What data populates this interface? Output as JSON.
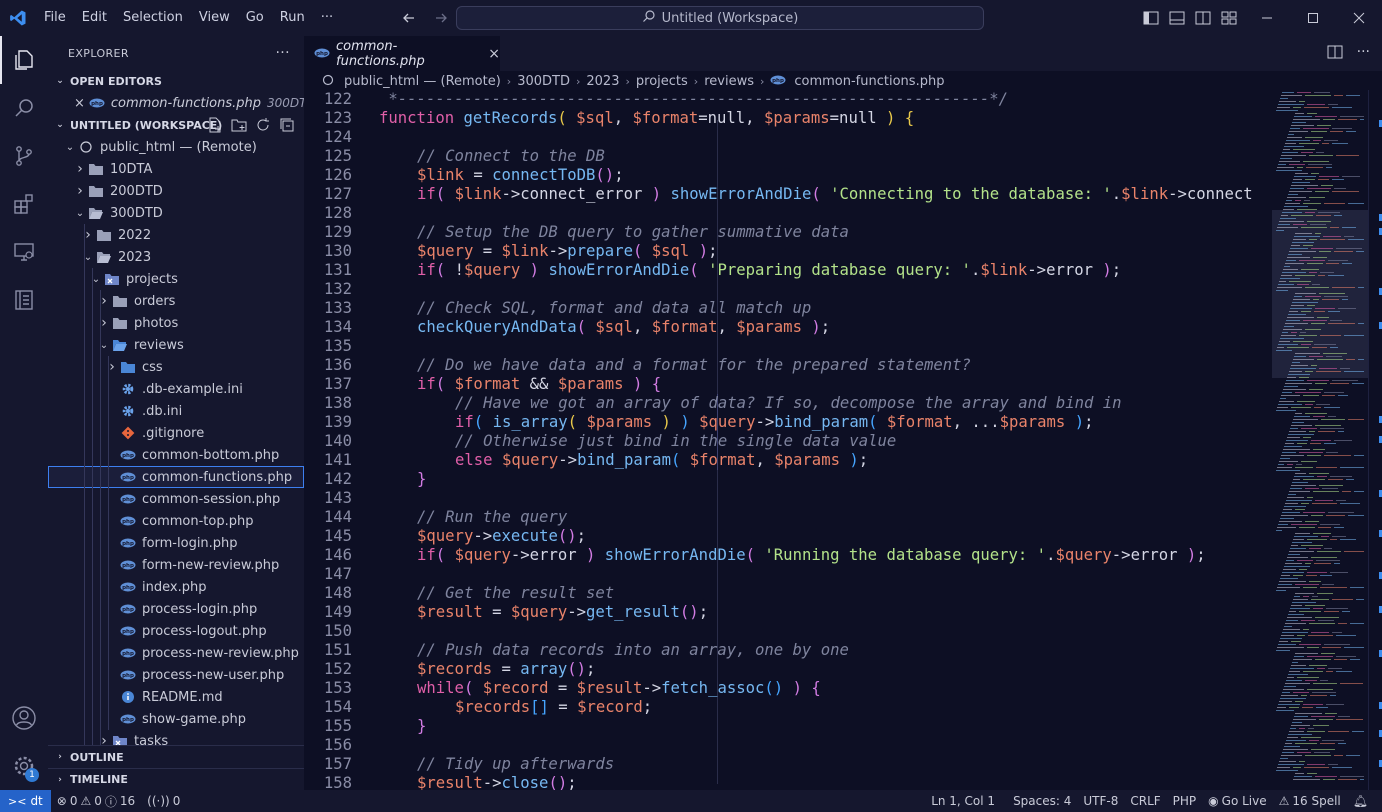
{
  "menu": [
    "File",
    "Edit",
    "Selection",
    "View",
    "Go",
    "Run",
    "···"
  ],
  "command_center": "Untitled (Workspace)",
  "sidebar": {
    "title": "EXPLORER",
    "more": "···",
    "open_editors_title": "OPEN EDITORS",
    "open_editor": {
      "name": "common-functions.php",
      "desc": "300DT..."
    },
    "workspace_title": "UNTITLED (WORKSPACE)",
    "tree": [
      {
        "label": "public_html — (Remote)",
        "depth": 0,
        "kind": "root",
        "twisty": "open"
      },
      {
        "label": "10DTA",
        "depth": 1,
        "kind": "folder",
        "twisty": "closed"
      },
      {
        "label": "200DTD",
        "depth": 1,
        "kind": "folder",
        "twisty": "closed"
      },
      {
        "label": "300DTD",
        "depth": 1,
        "kind": "folder-open",
        "twisty": "open"
      },
      {
        "label": "2022",
        "depth": 2,
        "kind": "folder",
        "twisty": "closed"
      },
      {
        "label": "2023",
        "depth": 2,
        "kind": "folder-open",
        "twisty": "open"
      },
      {
        "label": "projects",
        "depth": 3,
        "kind": "folder-special",
        "twisty": "open"
      },
      {
        "label": "orders",
        "depth": 4,
        "kind": "folder",
        "twisty": "closed"
      },
      {
        "label": "photos",
        "depth": 4,
        "kind": "folder",
        "twisty": "closed"
      },
      {
        "label": "reviews",
        "depth": 4,
        "kind": "folder-blue-open",
        "twisty": "open"
      },
      {
        "label": "css",
        "depth": 5,
        "kind": "folder-blue",
        "twisty": "closed"
      },
      {
        "label": ".db-example.ini",
        "depth": 5,
        "kind": "gear",
        "twisty": ""
      },
      {
        "label": ".db.ini",
        "depth": 5,
        "kind": "gear",
        "twisty": ""
      },
      {
        "label": ".gitignore",
        "depth": 5,
        "kind": "git",
        "twisty": ""
      },
      {
        "label": "common-bottom.php",
        "depth": 5,
        "kind": "php",
        "twisty": ""
      },
      {
        "label": "common-functions.php",
        "depth": 5,
        "kind": "php",
        "twisty": "",
        "selected": true
      },
      {
        "label": "common-session.php",
        "depth": 5,
        "kind": "php",
        "twisty": ""
      },
      {
        "label": "common-top.php",
        "depth": 5,
        "kind": "php",
        "twisty": ""
      },
      {
        "label": "form-login.php",
        "depth": 5,
        "kind": "php",
        "twisty": ""
      },
      {
        "label": "form-new-review.php",
        "depth": 5,
        "kind": "php",
        "twisty": ""
      },
      {
        "label": "index.php",
        "depth": 5,
        "kind": "php",
        "twisty": ""
      },
      {
        "label": "process-login.php",
        "depth": 5,
        "kind": "php",
        "twisty": ""
      },
      {
        "label": "process-logout.php",
        "depth": 5,
        "kind": "php",
        "twisty": ""
      },
      {
        "label": "process-new-review.php",
        "depth": 5,
        "kind": "php",
        "twisty": ""
      },
      {
        "label": "process-new-user.php",
        "depth": 5,
        "kind": "php",
        "twisty": ""
      },
      {
        "label": "README.md",
        "depth": 5,
        "kind": "info",
        "twisty": ""
      },
      {
        "label": "show-game.php",
        "depth": 5,
        "kind": "php",
        "twisty": ""
      },
      {
        "label": "tasks",
        "depth": 4,
        "kind": "folder-special",
        "twisty": "closed"
      }
    ],
    "outline_title": "OUTLINE",
    "timeline_title": "TIMELINE"
  },
  "tab": {
    "label": "common-functions.php",
    "close": "×"
  },
  "breadcrumbs": [
    "public_html — (Remote)",
    "300DTD",
    "2023",
    "projects",
    "reviews",
    "common-functions.php"
  ],
  "code": [
    {
      "n": "122",
      "i": 0,
      "t": [
        [
          "cmt",
          " *---------------------------------------------------------------*/"
        ]
      ]
    },
    {
      "n": "123",
      "i": 0,
      "t": [
        [
          "kw",
          "function "
        ],
        [
          "fn",
          "getRecords"
        ],
        [
          "br1",
          "( "
        ],
        [
          "var",
          "$sql"
        ],
        [
          "pn",
          ", "
        ],
        [
          "var",
          "$format"
        ],
        [
          "pn",
          "=null, "
        ],
        [
          "var",
          "$params"
        ],
        [
          "pn",
          "=null "
        ],
        [
          "br1",
          ")"
        ],
        [
          "pn",
          " "
        ],
        [
          "br1",
          "{"
        ]
      ]
    },
    {
      "n": "124",
      "i": 0,
      "t": []
    },
    {
      "n": "125",
      "i": 1,
      "t": [
        [
          "cmt",
          "// Connect to the DB"
        ]
      ]
    },
    {
      "n": "126",
      "i": 1,
      "t": [
        [
          "var",
          "$link"
        ],
        [
          "pn",
          " = "
        ],
        [
          "fn",
          "connectToDB"
        ],
        [
          "br2",
          "()"
        ],
        [
          "pn",
          ";"
        ]
      ]
    },
    {
      "n": "127",
      "i": 1,
      "t": [
        [
          "kw",
          "if"
        ],
        [
          "br2",
          "( "
        ],
        [
          "var",
          "$link"
        ],
        [
          "pn",
          "->connect_error "
        ],
        [
          "br2",
          ")"
        ],
        [
          "pn",
          " "
        ],
        [
          "fn",
          "showErrorAndDie"
        ],
        [
          "br2",
          "( "
        ],
        [
          "str",
          "'Connecting to the database: '"
        ],
        [
          "pn",
          "."
        ],
        [
          "var",
          "$link"
        ],
        [
          "pn",
          "->connect"
        ]
      ]
    },
    {
      "n": "128",
      "i": 0,
      "t": []
    },
    {
      "n": "129",
      "i": 1,
      "t": [
        [
          "cmt",
          "// Setup the DB query to gather summative data"
        ]
      ]
    },
    {
      "n": "130",
      "i": 1,
      "t": [
        [
          "var",
          "$query"
        ],
        [
          "pn",
          " = "
        ],
        [
          "var",
          "$link"
        ],
        [
          "pn",
          "->"
        ],
        [
          "fn",
          "prepare"
        ],
        [
          "br2",
          "( "
        ],
        [
          "var",
          "$sql"
        ],
        [
          "br2",
          " )"
        ],
        [
          "pn",
          ";"
        ]
      ]
    },
    {
      "n": "131",
      "i": 1,
      "t": [
        [
          "kw",
          "if"
        ],
        [
          "br2",
          "( "
        ],
        [
          "pn",
          "!"
        ],
        [
          "var",
          "$query"
        ],
        [
          "br2",
          " )"
        ],
        [
          "pn",
          " "
        ],
        [
          "fn",
          "showErrorAndDie"
        ],
        [
          "br2",
          "( "
        ],
        [
          "str",
          "'Preparing database query: '"
        ],
        [
          "pn",
          "."
        ],
        [
          "var",
          "$link"
        ],
        [
          "pn",
          "->error "
        ],
        [
          "br2",
          ")"
        ],
        [
          "pn",
          ";"
        ]
      ]
    },
    {
      "n": "132",
      "i": 0,
      "t": []
    },
    {
      "n": "133",
      "i": 1,
      "t": [
        [
          "cmt",
          "// Check SQL, format and data all match up"
        ]
      ]
    },
    {
      "n": "134",
      "i": 1,
      "t": [
        [
          "fn",
          "checkQueryAndData"
        ],
        [
          "br2",
          "( "
        ],
        [
          "var",
          "$sql"
        ],
        [
          "pn",
          ", "
        ],
        [
          "var",
          "$format"
        ],
        [
          "pn",
          ", "
        ],
        [
          "var",
          "$params"
        ],
        [
          "br2",
          " )"
        ],
        [
          "pn",
          ";"
        ]
      ]
    },
    {
      "n": "135",
      "i": 0,
      "t": []
    },
    {
      "n": "136",
      "i": 1,
      "t": [
        [
          "cmt",
          "// Do we have data and a format for the prepared statement?"
        ]
      ]
    },
    {
      "n": "137",
      "i": 1,
      "t": [
        [
          "kw",
          "if"
        ],
        [
          "br2",
          "( "
        ],
        [
          "var",
          "$format"
        ],
        [
          "pn",
          " && "
        ],
        [
          "var",
          "$params"
        ],
        [
          "br2",
          " )"
        ],
        [
          "pn",
          " "
        ],
        [
          "br2",
          "{"
        ]
      ]
    },
    {
      "n": "138",
      "i": 2,
      "t": [
        [
          "cmt",
          "// Have we got an array of data? If so, decompose the array and bind in"
        ]
      ]
    },
    {
      "n": "139",
      "i": 2,
      "t": [
        [
          "kw",
          "if"
        ],
        [
          "br3",
          "( "
        ],
        [
          "fn",
          "is_array"
        ],
        [
          "br1",
          "( "
        ],
        [
          "var",
          "$params"
        ],
        [
          "br1",
          " )"
        ],
        [
          "br3",
          " )"
        ],
        [
          "pn",
          " "
        ],
        [
          "var",
          "$query"
        ],
        [
          "pn",
          "->"
        ],
        [
          "fn",
          "bind_param"
        ],
        [
          "br3",
          "( "
        ],
        [
          "var",
          "$format"
        ],
        [
          "pn",
          ", ..."
        ],
        [
          "var",
          "$params"
        ],
        [
          "br3",
          " )"
        ],
        [
          "pn",
          ";"
        ]
      ]
    },
    {
      "n": "140",
      "i": 2,
      "t": [
        [
          "cmt",
          "// Otherwise just bind in the single data value"
        ]
      ]
    },
    {
      "n": "141",
      "i": 2,
      "t": [
        [
          "kw",
          "else"
        ],
        [
          "pn",
          " "
        ],
        [
          "var",
          "$query"
        ],
        [
          "pn",
          "->"
        ],
        [
          "fn",
          "bind_param"
        ],
        [
          "br3",
          "( "
        ],
        [
          "var",
          "$format"
        ],
        [
          "pn",
          ", "
        ],
        [
          "var",
          "$params"
        ],
        [
          "br3",
          " )"
        ],
        [
          "pn",
          ";"
        ]
      ]
    },
    {
      "n": "142",
      "i": 1,
      "t": [
        [
          "br2",
          "}"
        ]
      ]
    },
    {
      "n": "143",
      "i": 0,
      "t": []
    },
    {
      "n": "144",
      "i": 1,
      "t": [
        [
          "cmt",
          "// Run the query"
        ]
      ]
    },
    {
      "n": "145",
      "i": 1,
      "t": [
        [
          "var",
          "$query"
        ],
        [
          "pn",
          "->"
        ],
        [
          "fn",
          "execute"
        ],
        [
          "br2",
          "()"
        ],
        [
          "pn",
          ";"
        ]
      ]
    },
    {
      "n": "146",
      "i": 1,
      "t": [
        [
          "kw",
          "if"
        ],
        [
          "br2",
          "( "
        ],
        [
          "var",
          "$query"
        ],
        [
          "pn",
          "->error "
        ],
        [
          "br2",
          ")"
        ],
        [
          "pn",
          " "
        ],
        [
          "fn",
          "showErrorAndDie"
        ],
        [
          "br2",
          "( "
        ],
        [
          "str",
          "'Running the database query: '"
        ],
        [
          "pn",
          "."
        ],
        [
          "var",
          "$query"
        ],
        [
          "pn",
          "->error "
        ],
        [
          "br2",
          ")"
        ],
        [
          "pn",
          ";"
        ]
      ]
    },
    {
      "n": "147",
      "i": 0,
      "t": []
    },
    {
      "n": "148",
      "i": 1,
      "t": [
        [
          "cmt",
          "// Get the result set"
        ]
      ]
    },
    {
      "n": "149",
      "i": 1,
      "t": [
        [
          "var",
          "$result"
        ],
        [
          "pn",
          " = "
        ],
        [
          "var",
          "$query"
        ],
        [
          "pn",
          "->"
        ],
        [
          "fn",
          "get_result"
        ],
        [
          "br2",
          "()"
        ],
        [
          "pn",
          ";"
        ]
      ]
    },
    {
      "n": "150",
      "i": 0,
      "t": []
    },
    {
      "n": "151",
      "i": 1,
      "t": [
        [
          "cmt",
          "// Push data records into an array, one by one"
        ]
      ]
    },
    {
      "n": "152",
      "i": 1,
      "t": [
        [
          "var",
          "$records"
        ],
        [
          "pn",
          " = "
        ],
        [
          "fn",
          "array"
        ],
        [
          "br2",
          "()"
        ],
        [
          "pn",
          ";"
        ]
      ]
    },
    {
      "n": "153",
      "i": 1,
      "t": [
        [
          "kw",
          "while"
        ],
        [
          "br2",
          "( "
        ],
        [
          "var",
          "$record"
        ],
        [
          "pn",
          " = "
        ],
        [
          "var",
          "$result"
        ],
        [
          "pn",
          "->"
        ],
        [
          "fn",
          "fetch_assoc"
        ],
        [
          "br3",
          "()"
        ],
        [
          "br2",
          " )"
        ],
        [
          "pn",
          " "
        ],
        [
          "br2",
          "{"
        ]
      ]
    },
    {
      "n": "154",
      "i": 2,
      "t": [
        [
          "var",
          "$records"
        ],
        [
          "br3",
          "[]"
        ],
        [
          "pn",
          " = "
        ],
        [
          "var",
          "$record"
        ],
        [
          "pn",
          ";"
        ]
      ]
    },
    {
      "n": "155",
      "i": 1,
      "t": [
        [
          "br2",
          "}"
        ]
      ]
    },
    {
      "n": "156",
      "i": 0,
      "t": []
    },
    {
      "n": "157",
      "i": 1,
      "t": [
        [
          "cmt",
          "// Tidy up afterwards"
        ]
      ]
    },
    {
      "n": "158",
      "i": 1,
      "t": [
        [
          "var",
          "$result"
        ],
        [
          "pn",
          "->"
        ],
        [
          "fn",
          "close"
        ],
        [
          "br2",
          "()"
        ],
        [
          "pn",
          ";"
        ]
      ]
    }
  ],
  "status": {
    "remote": "dt",
    "errors": "0",
    "warnings": "0",
    "info": "16",
    "ports": "0",
    "position": "Ln 1, Col 1",
    "spaces": "Spaces: 4",
    "encoding": "UTF-8",
    "eol": "CRLF",
    "language": "PHP",
    "golive": "Go Live",
    "spell": "16 Spell"
  },
  "activity_badge": "1",
  "colors": {
    "accent": "#3d7ff0",
    "background": "#0d0f24",
    "sidebar": "#15172e",
    "remote": "#2563c9"
  }
}
